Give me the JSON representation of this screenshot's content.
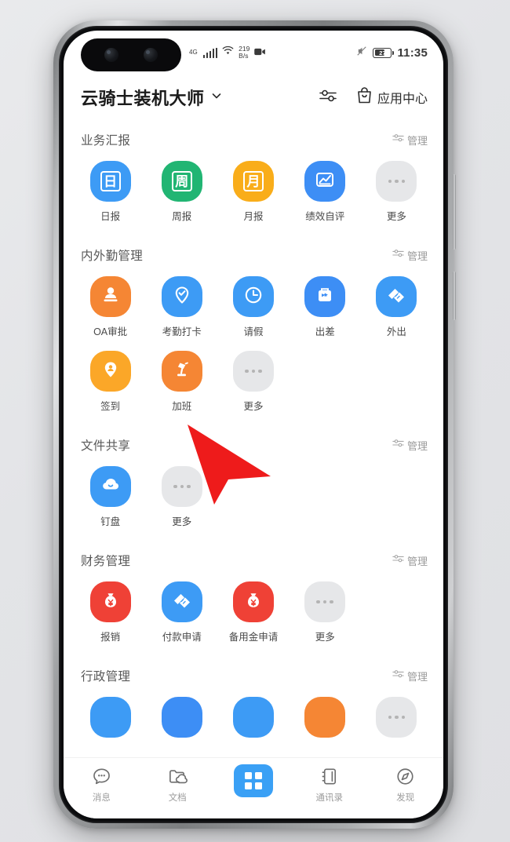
{
  "status_bar": {
    "signal_label": "4G",
    "network_speed_value": "219",
    "network_speed_unit": "B/s",
    "time": "11:35",
    "battery_percent": "27",
    "icons": [
      "signal-icon",
      "wifi-icon",
      "network-speed-icon",
      "video-recording-icon",
      "mute-icon",
      "battery-icon"
    ]
  },
  "header": {
    "title": "云骑士装机大师",
    "dropdown_icon": "chevron-down-icon",
    "filter_icon": "sliders-icon",
    "app_center_icon": "shopping-bag-icon",
    "app_center_label": "应用中心"
  },
  "common": {
    "manage_label": "管理",
    "manage_icon": "sliders-icon",
    "more_label": "更多",
    "more_icon": "ellipsis-icon"
  },
  "colors": {
    "blue": "#3d9bf5",
    "blue_dark": "#2f8ef4",
    "green": "#21b573",
    "amber": "#f9ad1a",
    "orange": "#f58634",
    "orange_light": "#fba728",
    "red": "#ef4136",
    "grey": "#e6e7e9",
    "label": "#4a4a4a",
    "section_title": "#595959"
  },
  "sections": [
    {
      "title": "业务汇报",
      "manage": "管理",
      "items": [
        {
          "label": "日报",
          "icon": "calendar-day-icon",
          "glyph": "日",
          "color": "#3d9bf5",
          "type": "cn"
        },
        {
          "label": "周报",
          "icon": "calendar-week-icon",
          "glyph": "周",
          "color": "#21b573",
          "type": "cn"
        },
        {
          "label": "月报",
          "icon": "calendar-month-icon",
          "glyph": "月",
          "color": "#f9ad1a",
          "type": "cn"
        },
        {
          "label": "绩效自评",
          "icon": "chart-growth-icon",
          "glyph": "",
          "color": "#3d8ef5",
          "type": "chart"
        },
        {
          "label": "更多",
          "icon": "ellipsis-icon",
          "glyph": "",
          "color": "#e6e7e9",
          "type": "more"
        }
      ]
    },
    {
      "title": "内外勤管理",
      "manage": "管理",
      "items": [
        {
          "label": "OA审批",
          "icon": "stamp-icon",
          "glyph": "",
          "color": "#f58634",
          "type": "stamp"
        },
        {
          "label": "考勤打卡",
          "icon": "location-check-icon",
          "glyph": "",
          "color": "#3d9bf5",
          "type": "pin"
        },
        {
          "label": "请假",
          "icon": "clock-icon",
          "glyph": "",
          "color": "#3d9bf5",
          "type": "clock"
        },
        {
          "label": "出差",
          "icon": "suitcase-plane-icon",
          "glyph": "",
          "color": "#3d8ef5",
          "type": "travel"
        },
        {
          "label": "外出",
          "icon": "handshake-icon",
          "glyph": "",
          "color": "#3d9bf5",
          "type": "handshake"
        },
        {
          "label": "签到",
          "icon": "location-person-icon",
          "glyph": "",
          "color": "#fba728",
          "type": "signin"
        },
        {
          "label": "加班",
          "icon": "desk-lamp-icon",
          "glyph": "",
          "color": "#f58634",
          "type": "lamp"
        },
        {
          "label": "更多",
          "icon": "ellipsis-icon",
          "glyph": "",
          "color": "#e6e7e9",
          "type": "more"
        }
      ]
    },
    {
      "title": "文件共享",
      "manage": "管理",
      "items": [
        {
          "label": "钉盘",
          "icon": "cloud-disk-icon",
          "glyph": "",
          "color": "#3d9bf5",
          "type": "cloud"
        },
        {
          "label": "更多",
          "icon": "ellipsis-icon",
          "glyph": "",
          "color": "#e6e7e9",
          "type": "more"
        }
      ]
    },
    {
      "title": "财务管理",
      "manage": "管理",
      "items": [
        {
          "label": "报销",
          "icon": "money-bag-icon",
          "glyph": "",
          "color": "#ef4136",
          "type": "moneybag"
        },
        {
          "label": "付款申请",
          "icon": "handshake-icon",
          "glyph": "",
          "color": "#3d9bf5",
          "type": "handshake"
        },
        {
          "label": "备用金申请",
          "icon": "money-bag-icon",
          "glyph": "",
          "color": "#ef4136",
          "type": "moneybag"
        },
        {
          "label": "更多",
          "icon": "ellipsis-icon",
          "glyph": "",
          "color": "#e6e7e9",
          "type": "more"
        }
      ]
    },
    {
      "title": "行政管理",
      "manage": "管理",
      "items": [
        {
          "label": "",
          "icon": "app-icon-1",
          "glyph": "",
          "color": "#3d9bf5",
          "type": "plain"
        },
        {
          "label": "",
          "icon": "app-icon-2",
          "glyph": "",
          "color": "#3d8ef5",
          "type": "plain"
        },
        {
          "label": "",
          "icon": "app-icon-3",
          "glyph": "",
          "color": "#3d9bf5",
          "type": "plain"
        },
        {
          "label": "",
          "icon": "app-icon-4",
          "glyph": "",
          "color": "#f58634",
          "type": "plain"
        },
        {
          "label": "",
          "icon": "ellipsis-icon",
          "glyph": "",
          "color": "#e6e7e9",
          "type": "more"
        }
      ]
    }
  ],
  "tab_bar": {
    "items": [
      {
        "label": "消息",
        "icon": "chat-bubble-icon",
        "active": false
      },
      {
        "label": "文档",
        "icon": "folder-cloud-icon",
        "active": false
      },
      {
        "label": "",
        "icon": "grid-workbench-icon",
        "active": true
      },
      {
        "label": "通讯录",
        "icon": "contacts-book-icon",
        "active": false
      },
      {
        "label": "发现",
        "icon": "compass-icon",
        "active": false
      }
    ]
  },
  "cursor": {
    "icon": "red-arrow-cursor",
    "color": "#ee1b1b"
  }
}
